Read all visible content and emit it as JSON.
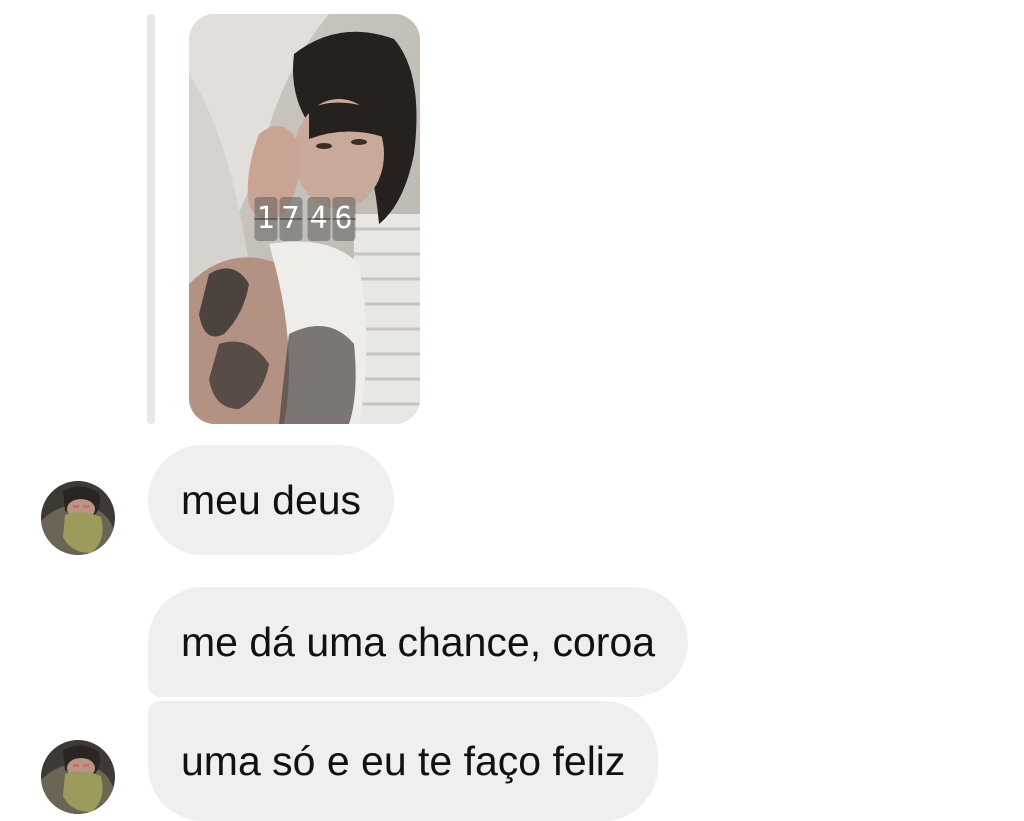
{
  "thread": {
    "story_reply": {
      "clock_digits": [
        "1",
        "7",
        "4",
        "6"
      ]
    },
    "messages": [
      {
        "text": "meu deus",
        "has_avatar": true
      },
      {
        "text": "me dá uma chance, coroa",
        "has_avatar": false
      },
      {
        "text": "uma só e eu te faço feliz",
        "has_avatar": true
      }
    ]
  },
  "colors": {
    "background": "#ffffff",
    "bubble": "#efeff0",
    "text": "#111111",
    "quote_bar": "#e7e8ea"
  },
  "icons": [
    "sender-avatar",
    "story-thumbnail",
    "flip-clock-sticker"
  ]
}
